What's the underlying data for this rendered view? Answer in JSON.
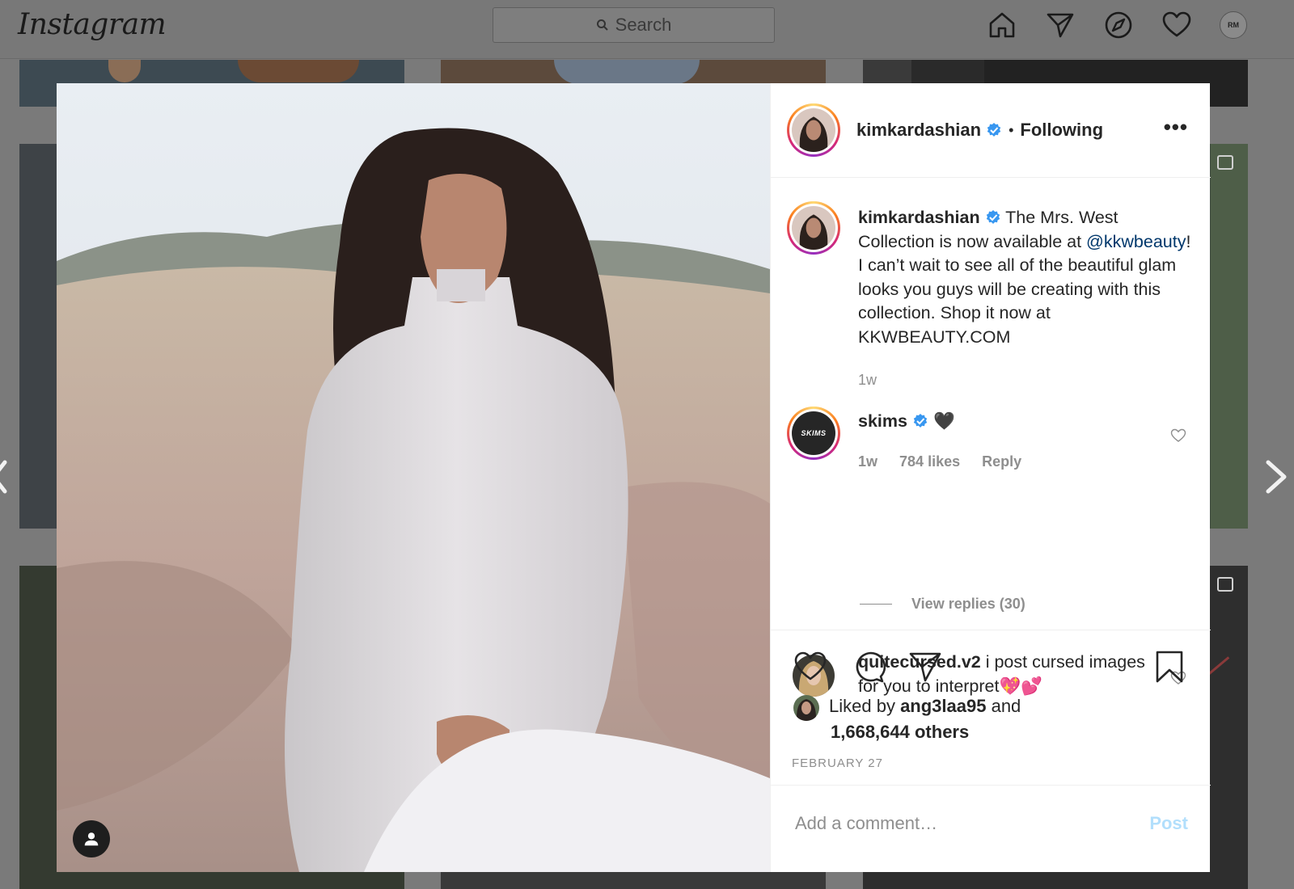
{
  "app": {
    "logo_text": "Instagram",
    "search_placeholder": "Search",
    "nav_icons": [
      "home-icon",
      "direct-icon",
      "explore-icon",
      "activity-heart-icon",
      "profile-avatar"
    ],
    "profile_initials": "RM"
  },
  "post": {
    "author": "kimkardashian",
    "verified": true,
    "separator": "•",
    "follow_status": "Following",
    "more_label": "•••",
    "caption": {
      "user": "kimkardashian",
      "text_before": " The Mrs. West Collection is now available at ",
      "mention": "@kkwbeauty",
      "text_after": "! I can’t wait to see all of the beautiful glam looks you guys will be creating with this collection. Shop it now at KKWBEAUTY.COM",
      "time": "1w"
    },
    "comments": [
      {
        "user": "skims",
        "verified": true,
        "text": " 🖤",
        "avatar_text": "SKIMS",
        "time": "1w",
        "likes": "784 likes",
        "reply_label": "Reply",
        "view_replies": "View replies (30)"
      },
      {
        "user": "quitecursed.v2",
        "verified": false,
        "text": " i post cursed images for you to interpret💖💕"
      }
    ],
    "liked_by": {
      "prefix": "Liked by ",
      "user": "ang3laa95",
      "middle": " and",
      "others": "1,668,644 others"
    },
    "date": "FEBRUARY 27",
    "add_comment_placeholder": "Add a comment…",
    "post_button": "Post"
  },
  "colors": {
    "verified_blue": "#3897f0",
    "mention": "#00376b",
    "post_disabled": "#b2dffc",
    "muted": "#8e8e8e"
  }
}
